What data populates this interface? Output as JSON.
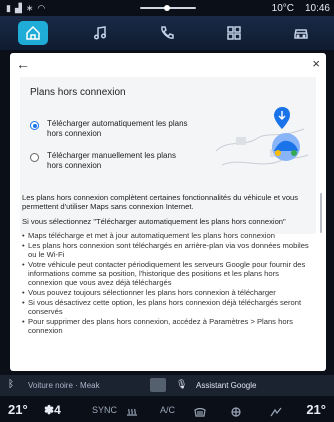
{
  "status_bar": {
    "temperature": "10°C",
    "time": "10:46"
  },
  "top_nav": {
    "tabs": [
      {
        "icon": "home-icon",
        "active": true
      },
      {
        "icon": "music-icon",
        "active": false
      },
      {
        "icon": "phone-icon",
        "active": false
      },
      {
        "icon": "apps-icon",
        "active": false
      },
      {
        "icon": "car-icon",
        "active": false
      }
    ]
  },
  "dialog": {
    "back_icon": "←",
    "close_icon": "×",
    "title": "Plans hors connexion",
    "options": [
      {
        "label": "Télécharger automatiquement les plans hors connexion",
        "selected": true
      },
      {
        "label": "Télécharger manuellement les plans hors connexion",
        "selected": false
      }
    ],
    "intro": "Les plans hors connexion complètent certaines fonctionnalités du véhicule et vous permettent d'utiliser Maps sans connexion Internet.",
    "if_selected": "Si vous sélectionnez \"Télécharger automatiquement les plans hors connexion\"",
    "bullets": [
      "Maps télécharge et met à jour automatiquement les plans hors connexion",
      "Les plans hors connexion sont téléchargés en arrière-plan via vos données mobiles ou le Wi-Fi",
      "Votre véhicule peut contacter périodiquement les serveurs Google pour fournir des informations comme sa position, l'historique des positions et les plans hors connexion que vous avez déjà téléchargés",
      "Vous pouvez toujours sélectionner les plans hors connexion à télécharger",
      "Si vous désactivez cette option, les plans hors connexion déjà téléchargés seront conservés",
      "Pour supprimer des plans hors connexion, accédez à Paramètres > Plans hors connexion"
    ]
  },
  "media_bar": {
    "source": "Voiture noire · Meak",
    "assistant": "Assistant Google"
  },
  "climate": {
    "left_temp": "21°",
    "fan": "4",
    "sync": "SYNC",
    "ac": "A/C",
    "right_temp": "21°"
  },
  "colors": {
    "accent": "#21c6f3",
    "radio_selected": "#1a73e8",
    "dialog_bg": "#ffffff",
    "card_bg": "#f4f5f7",
    "nav_bg": "#15243d"
  }
}
